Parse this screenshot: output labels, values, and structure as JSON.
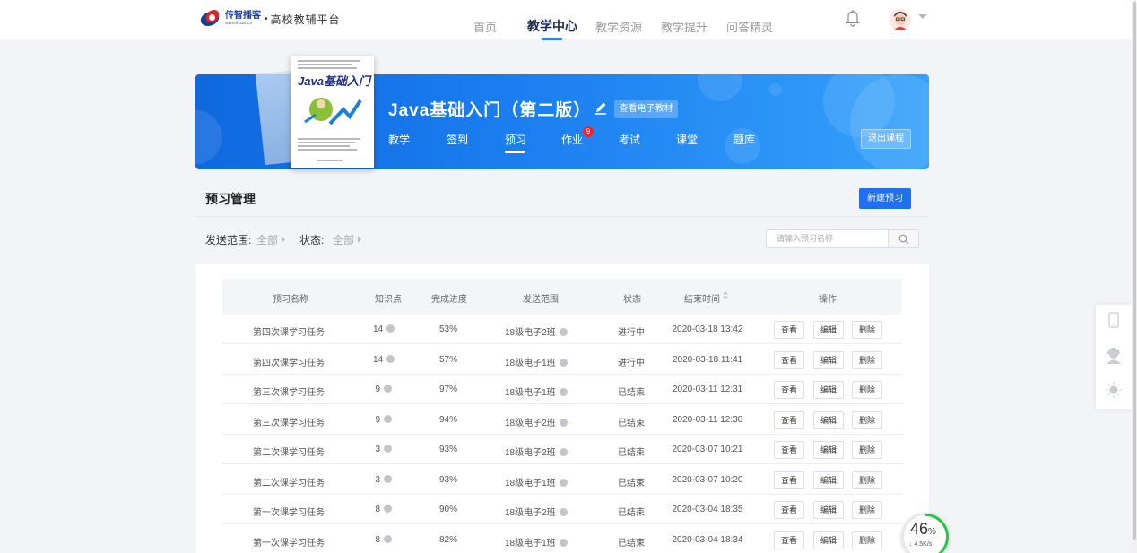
{
  "header": {
    "brand": "传智播客",
    "brand_url": "www.itcast.cn",
    "separator": "•",
    "platform": "高校教辅平台",
    "nav": [
      {
        "label": "首页",
        "active": false
      },
      {
        "label": "教学中心",
        "active": true
      },
      {
        "label": "教学资源",
        "active": false
      },
      {
        "label": "教学提升",
        "active": false
      },
      {
        "label": "问答精灵",
        "active": false
      }
    ]
  },
  "course": {
    "title": "Java基础入门（第二版）",
    "ebook_label": "查看电子教材",
    "book_cover_title": "Java基础入门",
    "tabs": [
      {
        "label": "教学",
        "active": false
      },
      {
        "label": "签到",
        "active": false
      },
      {
        "label": "预习",
        "active": true
      },
      {
        "label": "作业",
        "active": false,
        "badge": "9"
      },
      {
        "label": "考试",
        "active": false
      },
      {
        "label": "课堂",
        "active": false
      },
      {
        "label": "题库",
        "active": false
      }
    ],
    "exit_label": "退出课程"
  },
  "section": {
    "title": "预习管理",
    "new_label": "新建预习"
  },
  "filters": {
    "scope_label": "发送范围:",
    "scope_value": "全部",
    "status_label": "状态:",
    "status_value": "全部",
    "search_placeholder": "请输入预习名称"
  },
  "table": {
    "columns": [
      "预习名称",
      "知识点",
      "完成进度",
      "发送范围",
      "状态",
      "结束时间",
      "操作"
    ],
    "actions": [
      "查看",
      "编辑",
      "删除"
    ],
    "rows": [
      {
        "name": "第四次课学习任务",
        "points": "14",
        "progress": "53%",
        "scope": "18级电子2班",
        "status": "进行中",
        "end": "2020-03-18 13:42"
      },
      {
        "name": "第四次课学习任务",
        "points": "14",
        "progress": "57%",
        "scope": "18级电子1班",
        "status": "进行中",
        "end": "2020-03-18 11:41"
      },
      {
        "name": "第三次课学习任务",
        "points": "9",
        "progress": "97%",
        "scope": "18级电子1班",
        "status": "已结束",
        "end": "2020-03-11 12:31"
      },
      {
        "name": "第三次课学习任务",
        "points": "9",
        "progress": "94%",
        "scope": "18级电子2班",
        "status": "已结束",
        "end": "2020-03-11 12:30"
      },
      {
        "name": "第二次课学习任务",
        "points": "3",
        "progress": "93%",
        "scope": "18级电子2班",
        "status": "已结束",
        "end": "2020-03-07 10:21"
      },
      {
        "name": "第二次课学习任务",
        "points": "3",
        "progress": "93%",
        "scope": "18级电子1班",
        "status": "已结束",
        "end": "2020-03-07 10:20"
      },
      {
        "name": "第一次课学习任务",
        "points": "8",
        "progress": "90%",
        "scope": "18级电子2班",
        "status": "已结束",
        "end": "2020-03-04 18:35"
      },
      {
        "name": "第一次课学习任务",
        "points": "8",
        "progress": "82%",
        "scope": "18级电子1班",
        "status": "已结束",
        "end": "2020-03-04 18:34"
      }
    ]
  },
  "widgets": {
    "speed_percent": "46",
    "speed_percent_unit": "%",
    "speed_arrow": "↓",
    "speed_rate": "4.5K/s"
  },
  "colors": {
    "primary": "#1f6ff0",
    "banner_start": "#0f68de",
    "banner_end": "#35a1fb",
    "badge": "#f5222d"
  },
  "icons": [
    "bell-icon",
    "avatar",
    "edit-icon",
    "search-icon",
    "phone-icon",
    "support-icon",
    "idea-icon",
    "info-icon"
  ]
}
